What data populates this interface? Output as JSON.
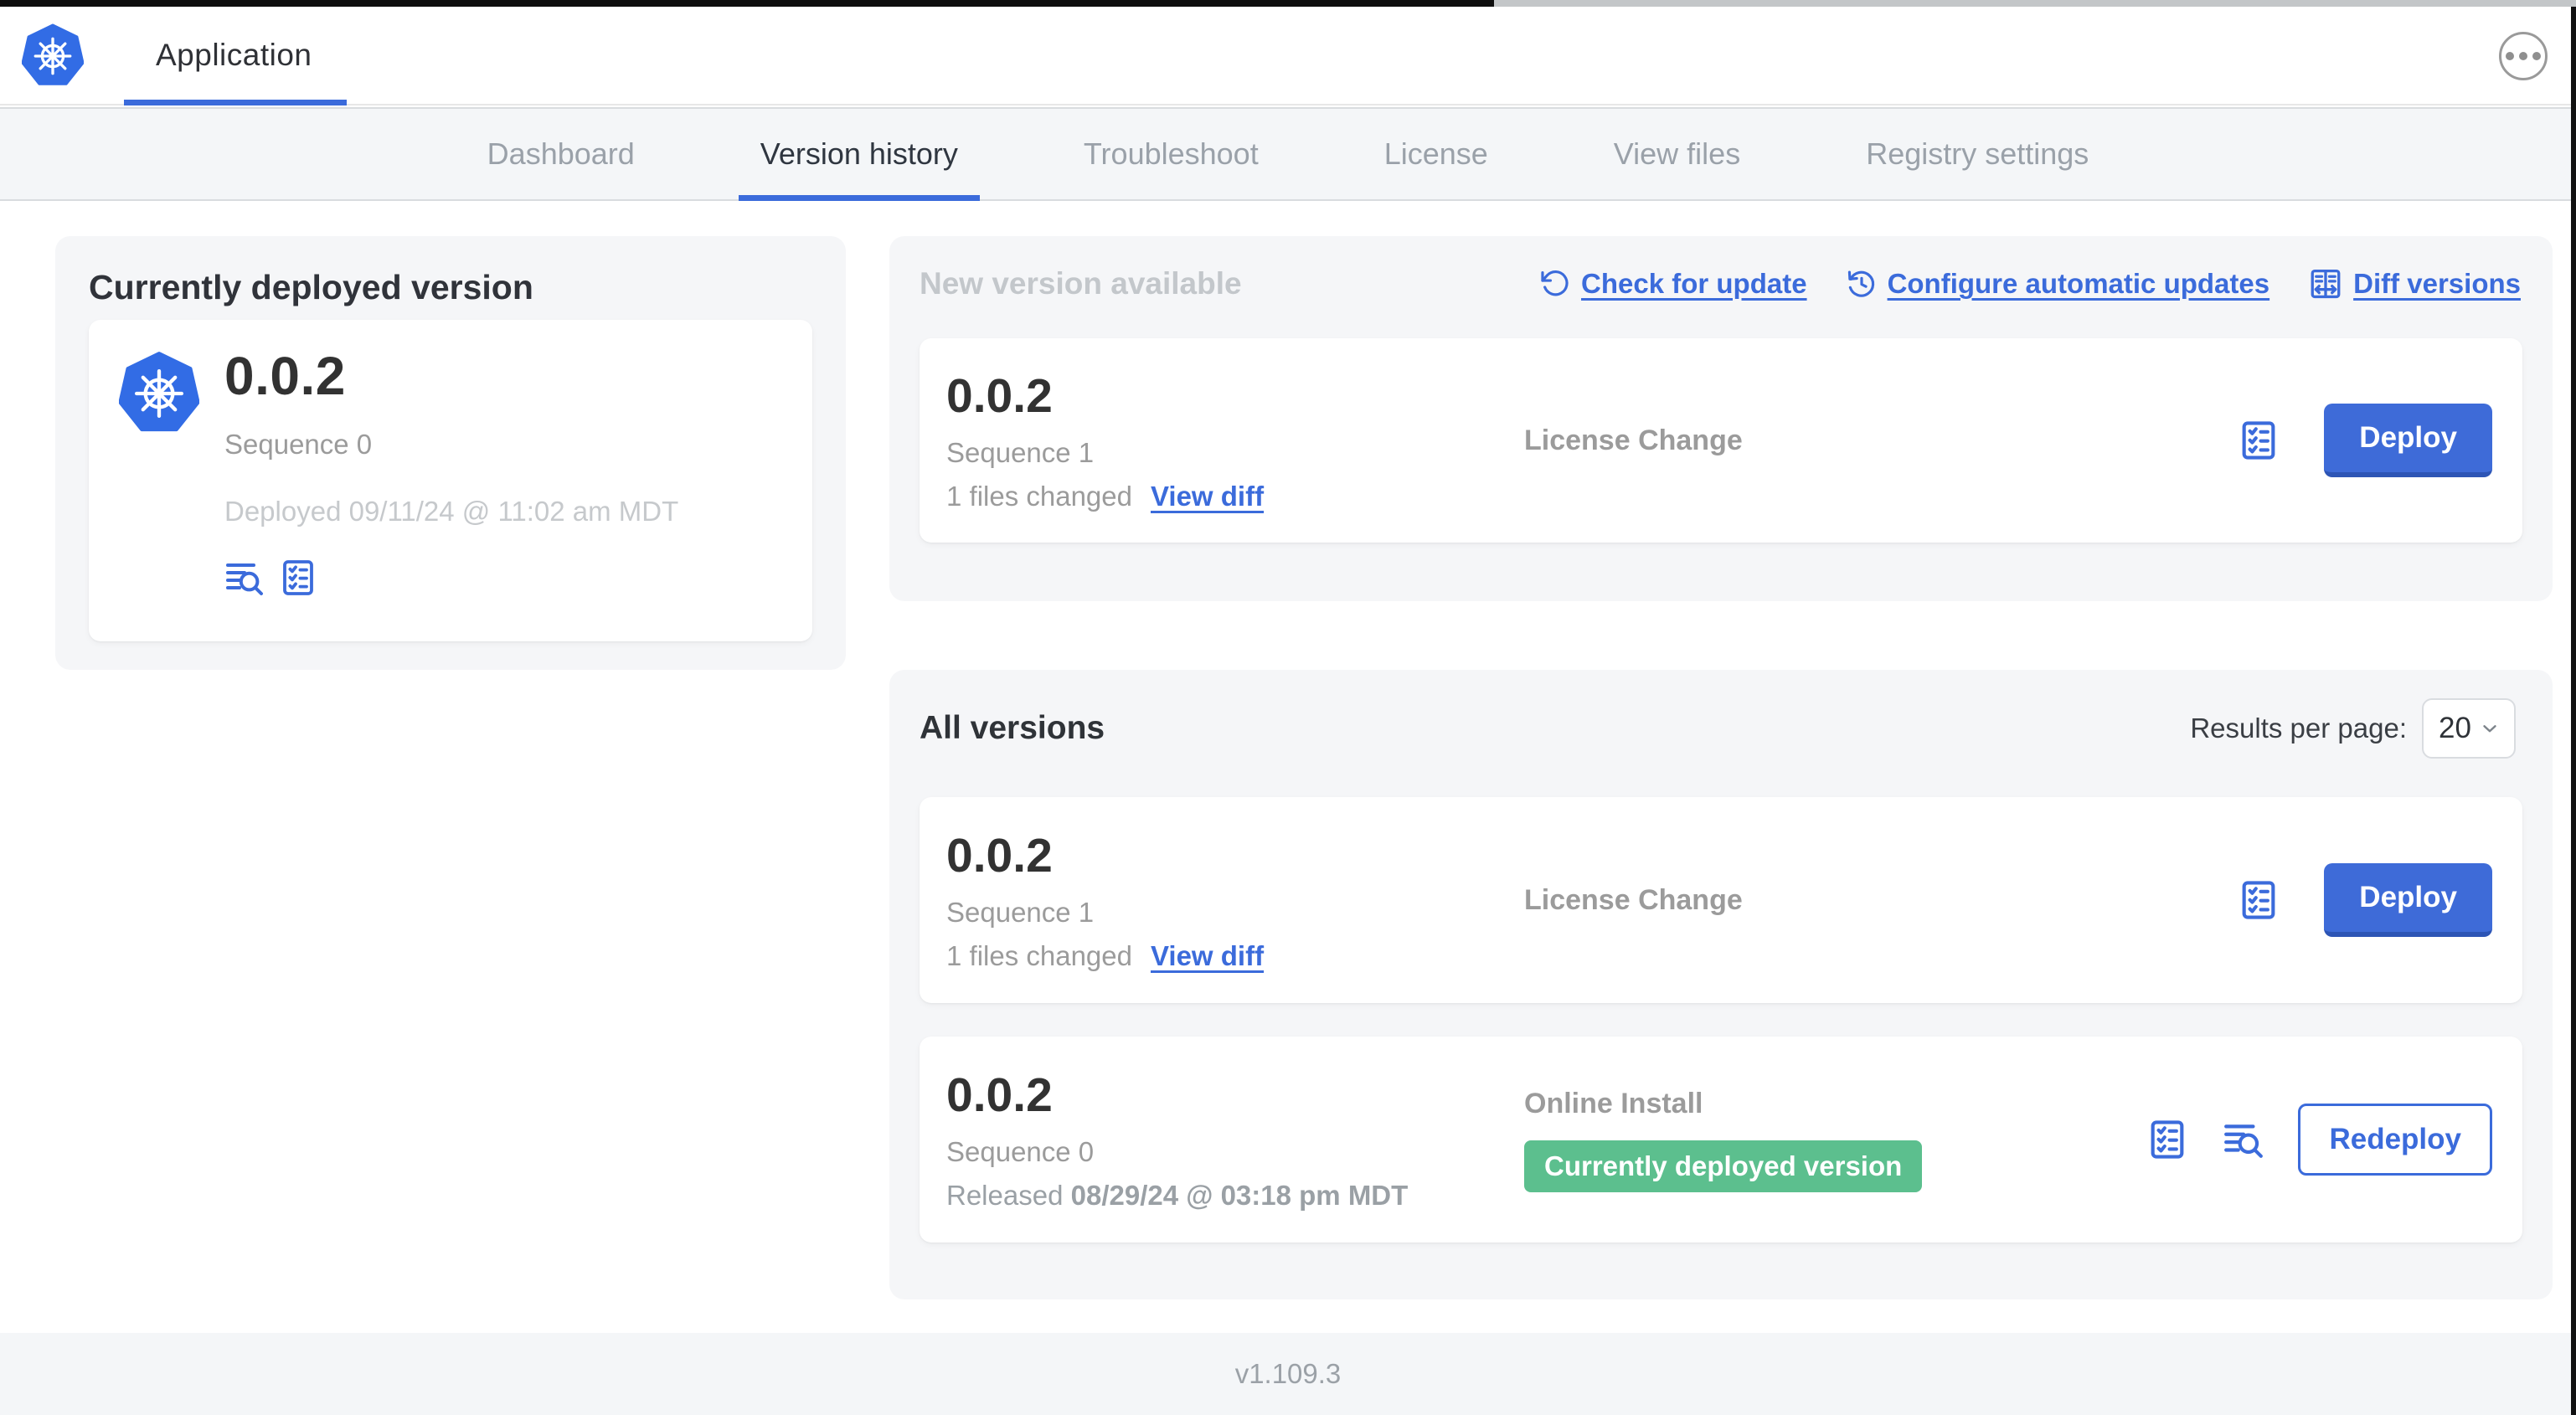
{
  "colors": {
    "accent_blue": "#3b6bdb",
    "logo_blue": "#326ce5",
    "badge_green": "#5cbf8e",
    "section_bg": "#f5f6f8",
    "text_dark": "#323232",
    "text_gray": "#9b9b9b",
    "text_light": "#c6c9cc"
  },
  "header": {
    "title": "Application"
  },
  "nav": {
    "tabs": [
      {
        "label": "Dashboard"
      },
      {
        "label": "Version history"
      },
      {
        "label": "Troubleshoot"
      },
      {
        "label": "License"
      },
      {
        "label": "View files"
      },
      {
        "label": "Registry settings"
      }
    ]
  },
  "current_version": {
    "title": "Currently deployed version",
    "version": "0.0.2",
    "sequence": "Sequence 0",
    "deployed": "Deployed 09/11/24 @ 11:02 am MDT"
  },
  "new_version": {
    "title": "New version available",
    "links": [
      {
        "label": "Check for update"
      },
      {
        "label": "Configure automatic updates"
      },
      {
        "label": "Diff versions"
      }
    ],
    "card": {
      "version": "0.0.2",
      "sequence": "Sequence 1",
      "files_changed": "1 files changed",
      "view_diff": "View diff",
      "source": "License Change",
      "action": "Deploy"
    }
  },
  "all_versions": {
    "title": "All versions",
    "results_per_page_label": "Results per page:",
    "results_per_page_value": "20",
    "rows": [
      {
        "version": "0.0.2",
        "sequence": "Sequence 1",
        "files_changed": "1 files changed",
        "view_diff": "View diff",
        "source": "License Change",
        "action": "Deploy"
      },
      {
        "version": "0.0.2",
        "sequence": "Sequence 0",
        "released_prefix": "Released",
        "released_date": "08/29/24 @ 03:18 pm MDT",
        "source": "Online Install",
        "badge": "Currently deployed version",
        "action": "Redeploy"
      }
    ]
  },
  "footer": {
    "version_label": "v1.109.3"
  }
}
